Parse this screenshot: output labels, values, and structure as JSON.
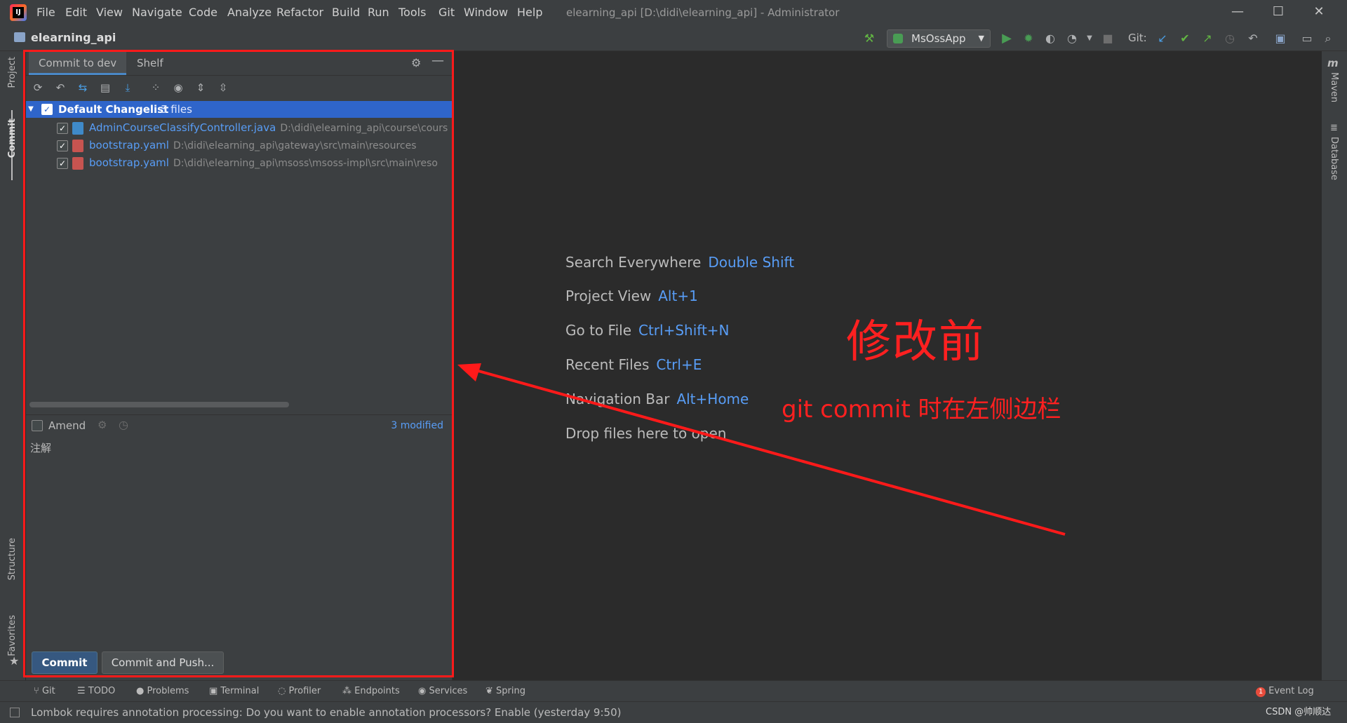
{
  "titlebar": {
    "menu": [
      "File",
      "Edit",
      "View",
      "Navigate",
      "Code",
      "Analyze",
      "Refactor",
      "Build",
      "Run",
      "Tools",
      "Git",
      "Window",
      "Help"
    ],
    "window_title": "elearning_api [D:\\didi\\elearning_api] - Administrator",
    "minimize": "—",
    "maximize": "☐",
    "close": "✕"
  },
  "navbar": {
    "project": "elearning_api",
    "run_config": "MsOssApp",
    "git_label": "Git:"
  },
  "left_strip": {
    "project": "Project",
    "commit": "Commit",
    "structure": "Structure",
    "favorites": "Favorites"
  },
  "right_strip": {
    "maven": "Maven",
    "database": "Database"
  },
  "commit_panel": {
    "tabs": [
      "Commit to dev",
      "Shelf"
    ],
    "changelist": {
      "name": "Default Changelist",
      "count": "3 files"
    },
    "files": [
      {
        "name": "AdminCourseClassifyController.java",
        "path": "D:\\didi\\elearning_api\\course\\cours",
        "type": "java"
      },
      {
        "name": "bootstrap.yaml",
        "path": "D:\\didi\\elearning_api\\gateway\\src\\main\\resources",
        "type": "yaml"
      },
      {
        "name": "bootstrap.yaml",
        "path": "D:\\didi\\elearning_api\\msoss\\msoss-impl\\src\\main\\reso",
        "type": "yaml"
      }
    ],
    "amend_label": "Amend",
    "modified": "3 modified",
    "message": "注解",
    "commit_button": "Commit",
    "commit_push_button": "Commit and Push..."
  },
  "editor_hints": [
    {
      "label": "Search Everywhere",
      "key": "Double Shift"
    },
    {
      "label": "Project View",
      "key": "Alt+1"
    },
    {
      "label": "Go to File",
      "key": "Ctrl+Shift+N"
    },
    {
      "label": "Recent Files",
      "key": "Ctrl+E"
    },
    {
      "label": "Navigation Bar",
      "key": "Alt+Home"
    },
    {
      "label": "Drop files here to open",
      "key": ""
    }
  ],
  "annotation": {
    "title": "修改前",
    "subtitle": "git commit 时在左侧边栏"
  },
  "toolwindows": [
    "Git",
    "TODO",
    "Problems",
    "Terminal",
    "Profiler",
    "Endpoints",
    "Services",
    "Spring"
  ],
  "event_log": "Event Log",
  "event_count": "1",
  "status": {
    "message": "Lombok requires annotation processing: Do you want to enable annotation processors? Enable (yesterday 9:50)",
    "watermark": "CSDN @帅顺达"
  },
  "colors": {
    "accent": "#589df6",
    "selection": "#2f65ca",
    "annotation": "#ff2020",
    "run_green": "#499c54"
  }
}
